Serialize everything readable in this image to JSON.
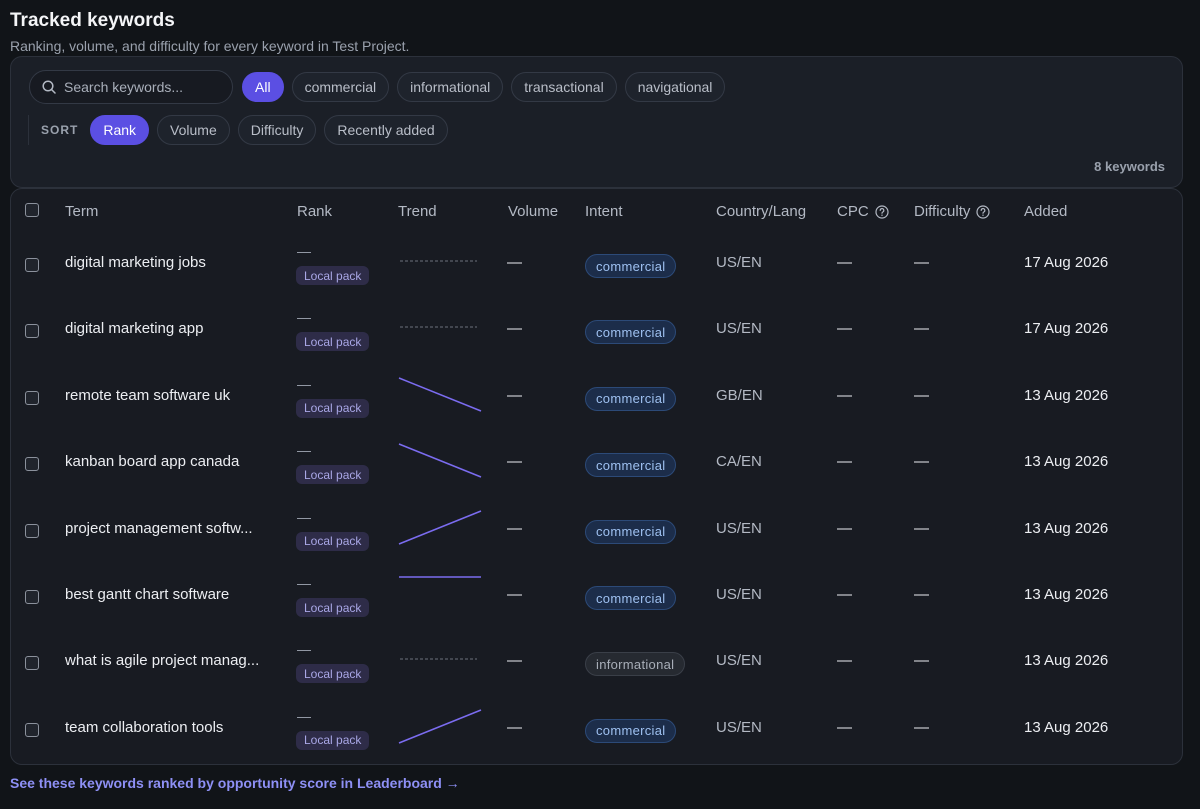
{
  "header": {
    "title": "Tracked keywords",
    "subtitle": "Ranking, volume, and difficulty for every keyword in Test Project."
  },
  "filters": {
    "search_placeholder": "Search keywords...",
    "intent_chips": [
      "All",
      "commercial",
      "informational",
      "transactional",
      "navigational"
    ],
    "active_intent": "All",
    "sort_label": "SORT",
    "sort_chips": [
      "Rank",
      "Volume",
      "Difficulty",
      "Recently added"
    ],
    "active_sort": "Rank",
    "count": "8 keywords"
  },
  "table": {
    "columns": {
      "term": "Term",
      "rank": "Rank",
      "trend": "Trend",
      "volume": "Volume",
      "intent": "Intent",
      "country": "Country/Lang",
      "cpc": "CPC",
      "difficulty": "Difficulty",
      "added": "Added"
    },
    "rows": [
      {
        "term": "digital marketing jobs",
        "rank": "—",
        "badge": "Local pack",
        "trend": "flat",
        "volume": "—",
        "intent": "commercial",
        "country": "US/EN",
        "cpc": "—",
        "difficulty": "—",
        "added": "17 Aug 2026"
      },
      {
        "term": "digital marketing app",
        "rank": "—",
        "badge": "Local pack",
        "trend": "flat",
        "volume": "—",
        "intent": "commercial",
        "country": "US/EN",
        "cpc": "—",
        "difficulty": "—",
        "added": "17 Aug 2026"
      },
      {
        "term": "remote team software uk",
        "rank": "—",
        "badge": "Local pack",
        "trend": "down",
        "volume": "—",
        "intent": "commercial",
        "country": "GB/EN",
        "cpc": "—",
        "difficulty": "—",
        "added": "13 Aug 2026"
      },
      {
        "term": "kanban board app canada",
        "rank": "—",
        "badge": "Local pack",
        "trend": "down",
        "volume": "—",
        "intent": "commercial",
        "country": "CA/EN",
        "cpc": "—",
        "difficulty": "—",
        "added": "13 Aug 2026"
      },
      {
        "term": "project management softw...",
        "rank": "—",
        "badge": "Local pack",
        "trend": "up",
        "volume": "—",
        "intent": "commercial",
        "country": "US/EN",
        "cpc": "—",
        "difficulty": "—",
        "added": "13 Aug 2026"
      },
      {
        "term": "best gantt chart software",
        "rank": "—",
        "badge": "Local pack",
        "trend": "level",
        "volume": "—",
        "intent": "commercial",
        "country": "US/EN",
        "cpc": "—",
        "difficulty": "—",
        "added": "13 Aug 2026"
      },
      {
        "term": "what is agile project manag...",
        "rank": "—",
        "badge": "Local pack",
        "trend": "flat",
        "volume": "—",
        "intent": "informational",
        "country": "US/EN",
        "cpc": "—",
        "difficulty": "—",
        "added": "13 Aug 2026"
      },
      {
        "term": "team collaboration tools",
        "rank": "—",
        "badge": "Local pack",
        "trend": "up",
        "volume": "—",
        "intent": "commercial",
        "country": "US/EN",
        "cpc": "—",
        "difficulty": "—",
        "added": "13 Aug 2026"
      }
    ]
  },
  "footer": {
    "link": "See these keywords ranked by opportunity score in Leaderboard →"
  },
  "colors": {
    "accent": "#5b4fe3",
    "trend_line": "#7b6cf0"
  }
}
